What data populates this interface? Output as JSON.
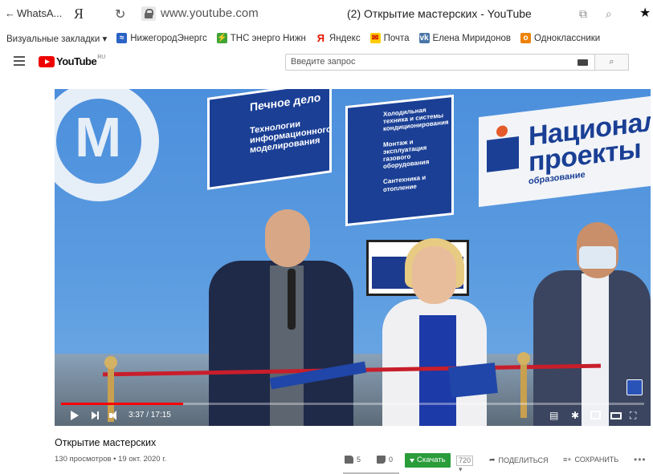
{
  "browser": {
    "back_label": "WhatsA...",
    "url": "www.youtube.com",
    "tab_title": "(2) Открытие мастерских - YouTube",
    "icons": [
      "back-arrow-icon",
      "yandex-y-icon",
      "reload-icon",
      "lock-icon",
      "tabs-icon",
      "search-icon",
      "star-icon"
    ]
  },
  "bookmarks": [
    {
      "label": "Визуальные закладки ▾",
      "icon": "none"
    },
    {
      "label": "НижегородЭнергс",
      "icon": "nn-energy-icon",
      "color": "#2a63c4"
    },
    {
      "label": "ТНС энерго Нижн",
      "icon": "tns-icon",
      "color": "#3fa535"
    },
    {
      "label": "Яндекс",
      "icon": "yandex-icon",
      "color": "#e61400"
    },
    {
      "label": "Почта",
      "icon": "mail-icon",
      "color": "#ffcc00"
    },
    {
      "label": "Елена Миридонов",
      "icon": "vk-icon",
      "color": "#4a76a8"
    },
    {
      "label": "Одноклассники",
      "icon": "ok-icon",
      "color": "#ee8208"
    }
  ],
  "youtube": {
    "logo_text": "YouTube",
    "logo_region": "RU",
    "search_placeholder": "Введите запрос"
  },
  "video": {
    "overlay_texts": {
      "sign1_line1": "Печное дело",
      "sign1_line2": "Технологии информационного моделирования",
      "sign2_line1": "Холодильная техника и системы кондиционирования",
      "sign2_line2": "Монтаж и эксплуатация газового оборудования",
      "sign2_line3": "Сантехника и отопление",
      "national_line1": "Националь",
      "national_line2": "проекты",
      "national_line3": "образование"
    },
    "time": "3:37 / 17:15",
    "progress": 0.21
  },
  "below": {
    "title": "Открытие мастерских",
    "meta": "130 просмотров • 19 окт. 2020 г.",
    "likes": "5",
    "dislikes": "0",
    "download_label": "Скачать",
    "quality": "720 ▾",
    "share_label": "ПОДЕЛИТЬСЯ",
    "save_label": "СОХРАНИТЬ",
    "more": "•••"
  },
  "colors": {
    "youtube_red": "#ff0000",
    "download_green": "#2a9c3a",
    "sign_blue": "#1a3f95"
  }
}
